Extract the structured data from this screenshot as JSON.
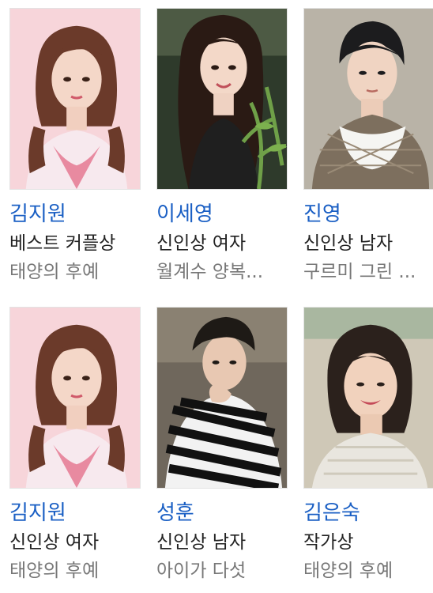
{
  "cards": [
    {
      "name": "김지원",
      "award": "베스트 커플상",
      "work": "태양의 후예",
      "photo": "actress-kim-jiwon-photo",
      "bg": "#f6d3d8"
    },
    {
      "name": "이세영",
      "award": "신인상 여자",
      "work": "월계수 양복...",
      "photo": "actress-lee-seyoung-photo",
      "bg": "#2f3a2c"
    },
    {
      "name": "진영",
      "award": "신인상 남자",
      "work": "구르미 그린 ...",
      "photo": "actor-jinyoung-photo",
      "bg": "#b8b2a6"
    },
    {
      "name": "김지원",
      "award": "신인상 여자",
      "work": "태양의 후예",
      "photo": "actress-kim-jiwon-photo",
      "bg": "#f6d3d8"
    },
    {
      "name": "성훈",
      "award": "신인상 남자",
      "work": "아이가 다섯",
      "photo": "actor-sunghoon-photo",
      "bg": "#6a6258"
    },
    {
      "name": "김은숙",
      "award": "작가상",
      "work": "태양의 후예",
      "photo": "writer-kim-eunsook-photo",
      "bg": "#c9c2b0"
    }
  ],
  "colors": {
    "name": "#1a5fc4",
    "award": "#222222",
    "work": "#777777"
  }
}
